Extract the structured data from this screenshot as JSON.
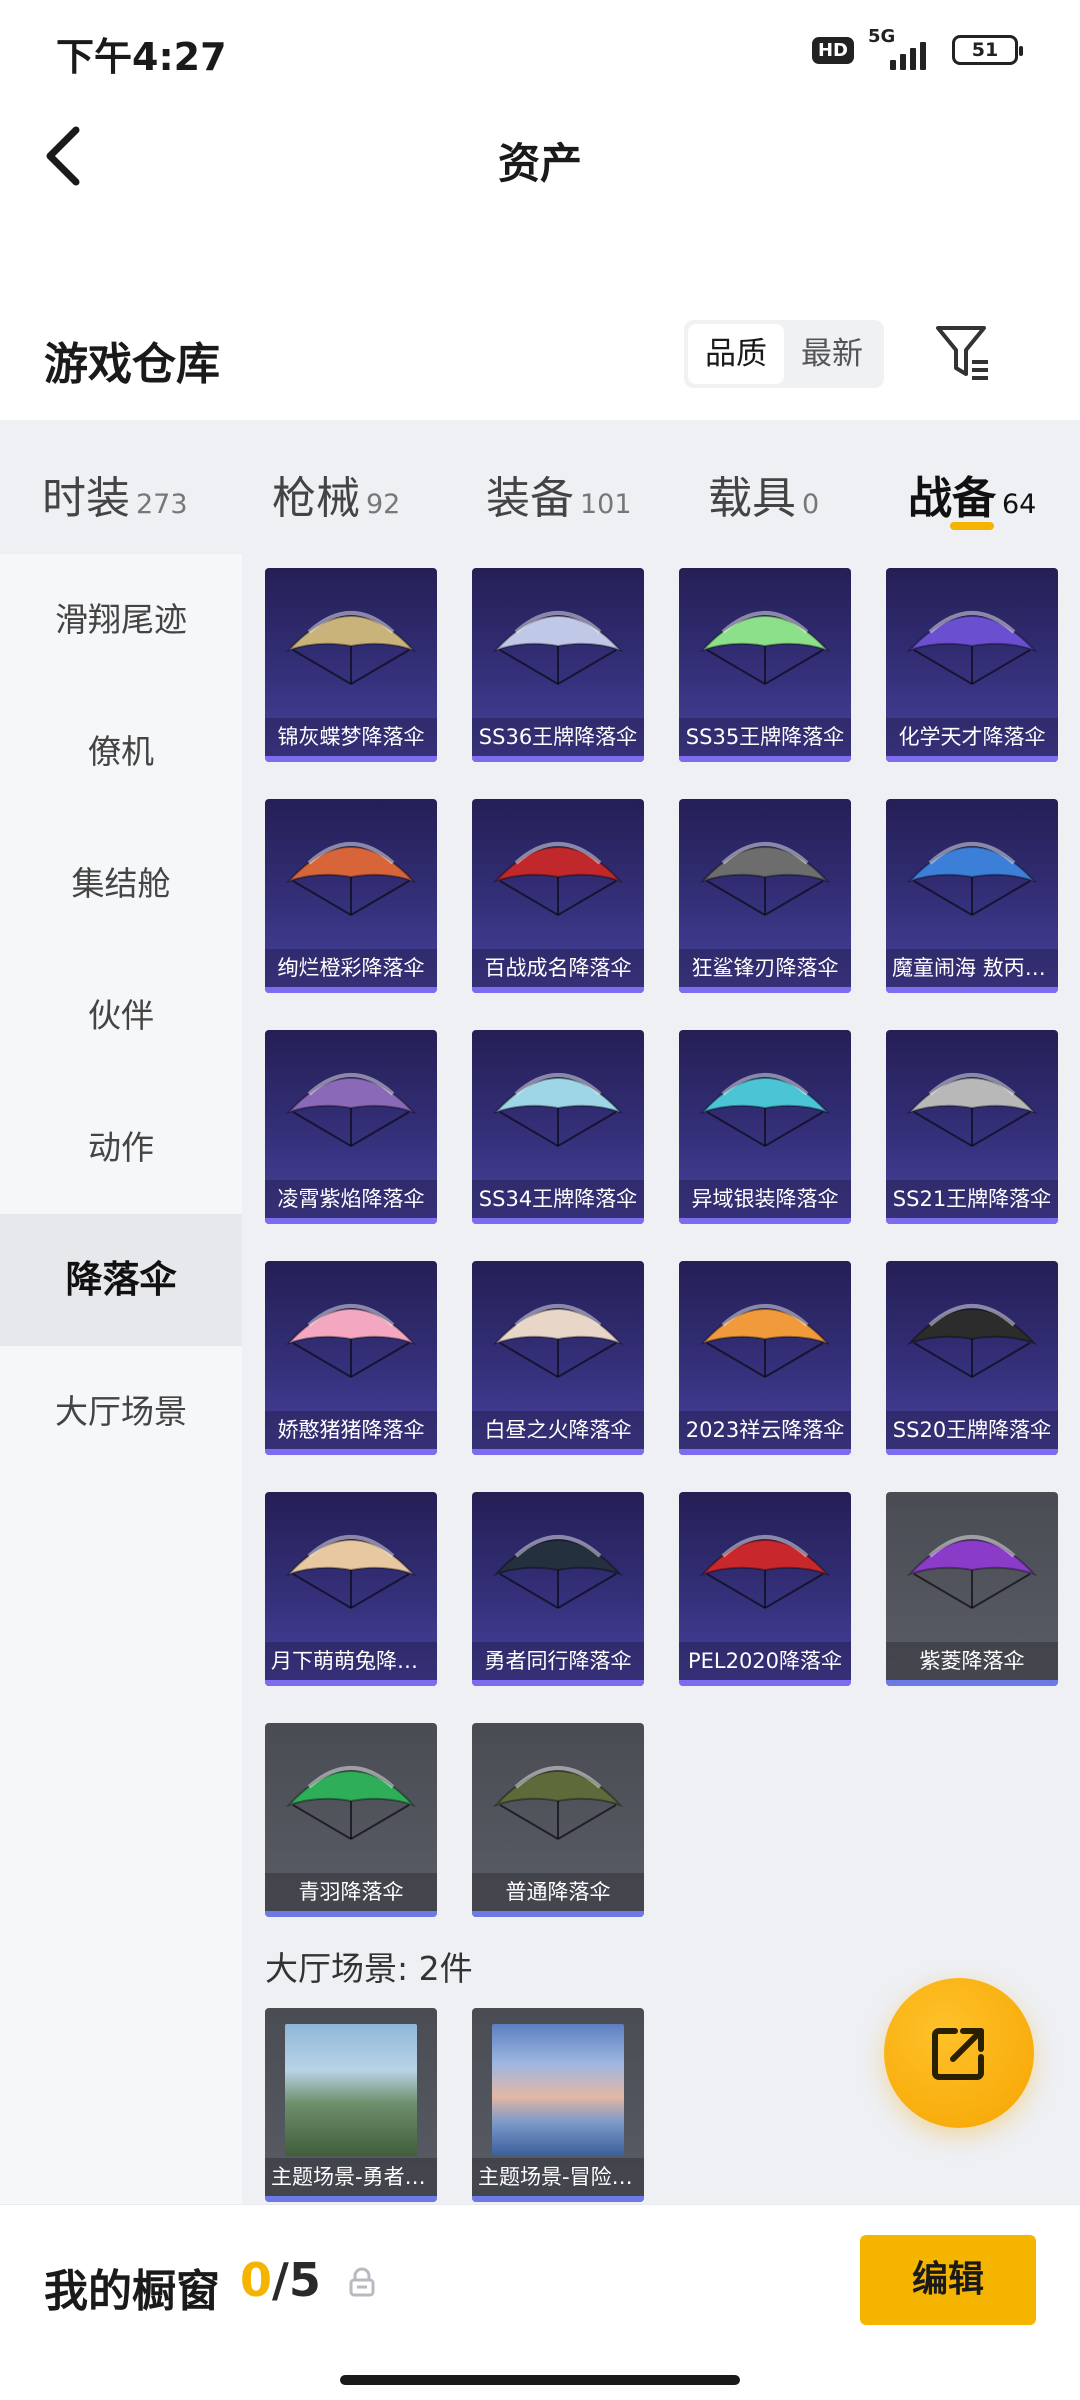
{
  "status_bar": {
    "time": "下午4:27",
    "hd_label": "HD",
    "network_label": "5G",
    "battery_level": "51"
  },
  "header": {
    "title": "资产"
  },
  "warehouse": {
    "title": "游戏仓库",
    "sort_options": [
      "品质",
      "最新"
    ],
    "sort_selected": "品质"
  },
  "tabs": [
    {
      "label": "时装",
      "count": "273"
    },
    {
      "label": "枪械",
      "count": "92"
    },
    {
      "label": "装备",
      "count": "101"
    },
    {
      "label": "载具",
      "count": "0"
    },
    {
      "label": "战备",
      "count": "64"
    }
  ],
  "active_tab": "战备",
  "sidebar": {
    "items": [
      "滑翔尾迹",
      "僚机",
      "集结舱",
      "伙伴",
      "动作",
      "降落伞",
      "大厅场景"
    ],
    "active": "降落伞"
  },
  "parachutes": [
    {
      "name": "锦灰蝶梦降落伞",
      "color": "#c9b37a"
    },
    {
      "name": "SS36王牌降落伞",
      "color": "#c0c8e8"
    },
    {
      "name": "SS35王牌降落伞",
      "color": "#8de08a"
    },
    {
      "name": "化学天才降落伞",
      "color": "#6a4fd0"
    },
    {
      "name": "绚烂橙彩降落伞",
      "color": "#d8643a"
    },
    {
      "name": "百战成名降落伞",
      "color": "#c0282c"
    },
    {
      "name": "狂鲨锋刃降落伞",
      "color": "#6d6d6d"
    },
    {
      "name": "魔童闹海 敖丙降落伞",
      "color": "#3c7fd8"
    },
    {
      "name": "凌霄紫焰降落伞",
      "color": "#8a6ab8"
    },
    {
      "name": "SS34王牌降落伞",
      "color": "#9fd6e6"
    },
    {
      "name": "异域银装降落伞",
      "color": "#4bc5d6"
    },
    {
      "name": "SS21王牌降落伞",
      "color": "#b8b8b8"
    },
    {
      "name": "娇憨猪猪降落伞",
      "color": "#f3a7c0"
    },
    {
      "name": "白昼之火降落伞",
      "color": "#e8d6c8"
    },
    {
      "name": "2023祥云降落伞",
      "color": "#f09a3c"
    },
    {
      "name": "SS20王牌降落伞",
      "color": "#2c2c2c"
    },
    {
      "name": "月下萌萌兔降落伞",
      "color": "#e8c8a0"
    },
    {
      "name": "勇者同行降落伞",
      "color": "#24303e"
    },
    {
      "name": "PEL2020降落伞",
      "color": "#c8282c"
    },
    {
      "name": "紫菱降落伞",
      "color": "#8a3cc8",
      "gray": true
    },
    {
      "name": "青羽降落伞",
      "color": "#2fae5a",
      "gray": true
    },
    {
      "name": "普通降落伞",
      "color": "#5d6b3a",
      "gray": true
    }
  ],
  "lobby_section": {
    "label": "大厅场景: 2件",
    "items": [
      {
        "name": "主题场景-勇者之路"
      },
      {
        "name": "主题场景-冒险之旅"
      }
    ]
  },
  "bottom_bar": {
    "showcase_label": "我的橱窗",
    "current": "0",
    "separator": "/",
    "max": "5",
    "edit_label": "编辑"
  },
  "colors": {
    "accent": "#f5b400",
    "card_purple": "#35307a",
    "card_gray": "#5b5d66"
  }
}
